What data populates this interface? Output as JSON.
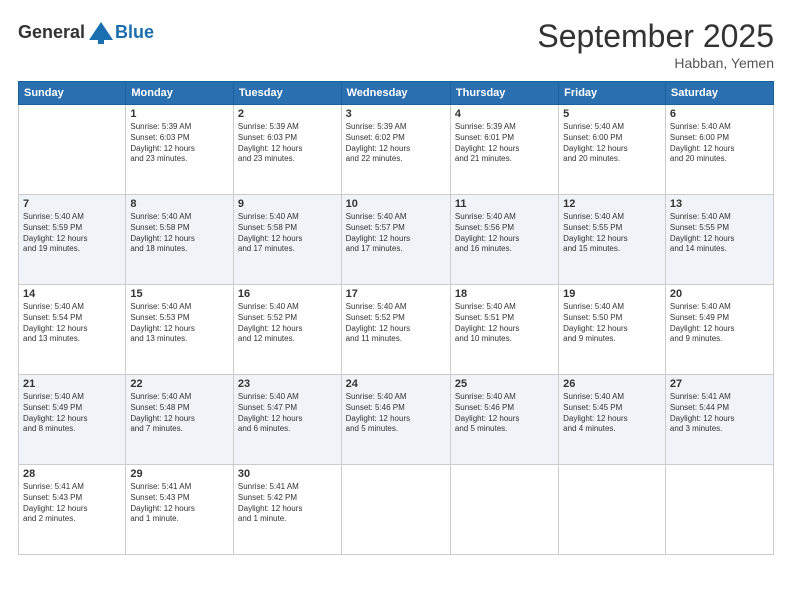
{
  "header": {
    "logo_general": "General",
    "logo_blue": "Blue",
    "month": "September 2025",
    "location": "Habban, Yemen"
  },
  "days_of_week": [
    "Sunday",
    "Monday",
    "Tuesday",
    "Wednesday",
    "Thursday",
    "Friday",
    "Saturday"
  ],
  "weeks": [
    [
      {
        "day": "",
        "info": ""
      },
      {
        "day": "1",
        "info": "Sunrise: 5:39 AM\nSunset: 6:03 PM\nDaylight: 12 hours\nand 23 minutes."
      },
      {
        "day": "2",
        "info": "Sunrise: 5:39 AM\nSunset: 6:03 PM\nDaylight: 12 hours\nand 23 minutes."
      },
      {
        "day": "3",
        "info": "Sunrise: 5:39 AM\nSunset: 6:02 PM\nDaylight: 12 hours\nand 22 minutes."
      },
      {
        "day": "4",
        "info": "Sunrise: 5:39 AM\nSunset: 6:01 PM\nDaylight: 12 hours\nand 21 minutes."
      },
      {
        "day": "5",
        "info": "Sunrise: 5:40 AM\nSunset: 6:00 PM\nDaylight: 12 hours\nand 20 minutes."
      },
      {
        "day": "6",
        "info": "Sunrise: 5:40 AM\nSunset: 6:00 PM\nDaylight: 12 hours\nand 20 minutes."
      }
    ],
    [
      {
        "day": "7",
        "info": "Sunrise: 5:40 AM\nSunset: 5:59 PM\nDaylight: 12 hours\nand 19 minutes."
      },
      {
        "day": "8",
        "info": "Sunrise: 5:40 AM\nSunset: 5:58 PM\nDaylight: 12 hours\nand 18 minutes."
      },
      {
        "day": "9",
        "info": "Sunrise: 5:40 AM\nSunset: 5:58 PM\nDaylight: 12 hours\nand 17 minutes."
      },
      {
        "day": "10",
        "info": "Sunrise: 5:40 AM\nSunset: 5:57 PM\nDaylight: 12 hours\nand 17 minutes."
      },
      {
        "day": "11",
        "info": "Sunrise: 5:40 AM\nSunset: 5:56 PM\nDaylight: 12 hours\nand 16 minutes."
      },
      {
        "day": "12",
        "info": "Sunrise: 5:40 AM\nSunset: 5:55 PM\nDaylight: 12 hours\nand 15 minutes."
      },
      {
        "day": "13",
        "info": "Sunrise: 5:40 AM\nSunset: 5:55 PM\nDaylight: 12 hours\nand 14 minutes."
      }
    ],
    [
      {
        "day": "14",
        "info": "Sunrise: 5:40 AM\nSunset: 5:54 PM\nDaylight: 12 hours\nand 13 minutes."
      },
      {
        "day": "15",
        "info": "Sunrise: 5:40 AM\nSunset: 5:53 PM\nDaylight: 12 hours\nand 13 minutes."
      },
      {
        "day": "16",
        "info": "Sunrise: 5:40 AM\nSunset: 5:52 PM\nDaylight: 12 hours\nand 12 minutes."
      },
      {
        "day": "17",
        "info": "Sunrise: 5:40 AM\nSunset: 5:52 PM\nDaylight: 12 hours\nand 11 minutes."
      },
      {
        "day": "18",
        "info": "Sunrise: 5:40 AM\nSunset: 5:51 PM\nDaylight: 12 hours\nand 10 minutes."
      },
      {
        "day": "19",
        "info": "Sunrise: 5:40 AM\nSunset: 5:50 PM\nDaylight: 12 hours\nand 9 minutes."
      },
      {
        "day": "20",
        "info": "Sunrise: 5:40 AM\nSunset: 5:49 PM\nDaylight: 12 hours\nand 9 minutes."
      }
    ],
    [
      {
        "day": "21",
        "info": "Sunrise: 5:40 AM\nSunset: 5:49 PM\nDaylight: 12 hours\nand 8 minutes."
      },
      {
        "day": "22",
        "info": "Sunrise: 5:40 AM\nSunset: 5:48 PM\nDaylight: 12 hours\nand 7 minutes."
      },
      {
        "day": "23",
        "info": "Sunrise: 5:40 AM\nSunset: 5:47 PM\nDaylight: 12 hours\nand 6 minutes."
      },
      {
        "day": "24",
        "info": "Sunrise: 5:40 AM\nSunset: 5:46 PM\nDaylight: 12 hours\nand 5 minutes."
      },
      {
        "day": "25",
        "info": "Sunrise: 5:40 AM\nSunset: 5:46 PM\nDaylight: 12 hours\nand 5 minutes."
      },
      {
        "day": "26",
        "info": "Sunrise: 5:40 AM\nSunset: 5:45 PM\nDaylight: 12 hours\nand 4 minutes."
      },
      {
        "day": "27",
        "info": "Sunrise: 5:41 AM\nSunset: 5:44 PM\nDaylight: 12 hours\nand 3 minutes."
      }
    ],
    [
      {
        "day": "28",
        "info": "Sunrise: 5:41 AM\nSunset: 5:43 PM\nDaylight: 12 hours\nand 2 minutes."
      },
      {
        "day": "29",
        "info": "Sunrise: 5:41 AM\nSunset: 5:43 PM\nDaylight: 12 hours\nand 1 minute."
      },
      {
        "day": "30",
        "info": "Sunrise: 5:41 AM\nSunset: 5:42 PM\nDaylight: 12 hours\nand 1 minute."
      },
      {
        "day": "",
        "info": ""
      },
      {
        "day": "",
        "info": ""
      },
      {
        "day": "",
        "info": ""
      },
      {
        "day": "",
        "info": ""
      }
    ]
  ]
}
